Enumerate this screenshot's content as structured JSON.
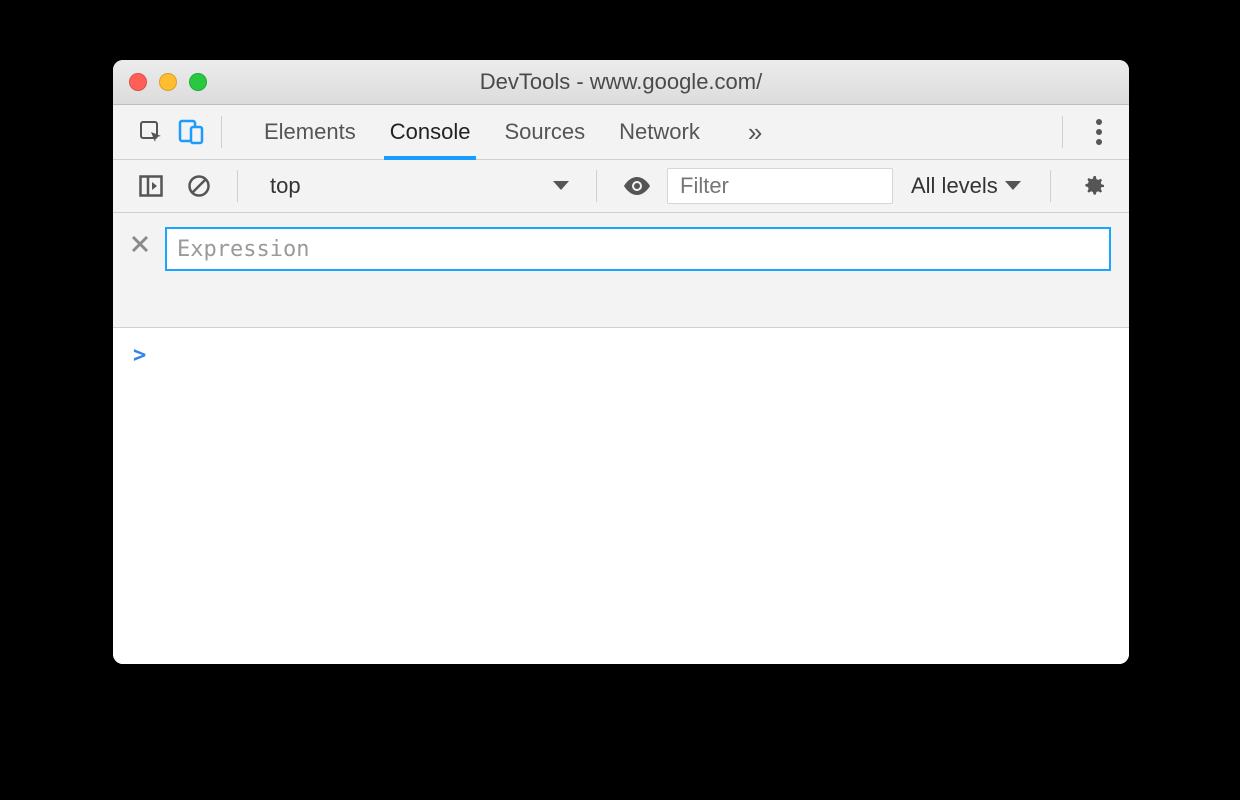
{
  "window": {
    "title": "DevTools - www.google.com/"
  },
  "tabs": {
    "items": [
      {
        "label": "Elements",
        "active": false
      },
      {
        "label": "Console",
        "active": true
      },
      {
        "label": "Sources",
        "active": false
      },
      {
        "label": "Network",
        "active": false
      }
    ],
    "overflow_glyph": "»"
  },
  "console_toolbar": {
    "context": "top",
    "filter_placeholder": "Filter",
    "levels": "All levels"
  },
  "expression": {
    "placeholder": "Expression"
  },
  "console": {
    "prompt": ">"
  }
}
